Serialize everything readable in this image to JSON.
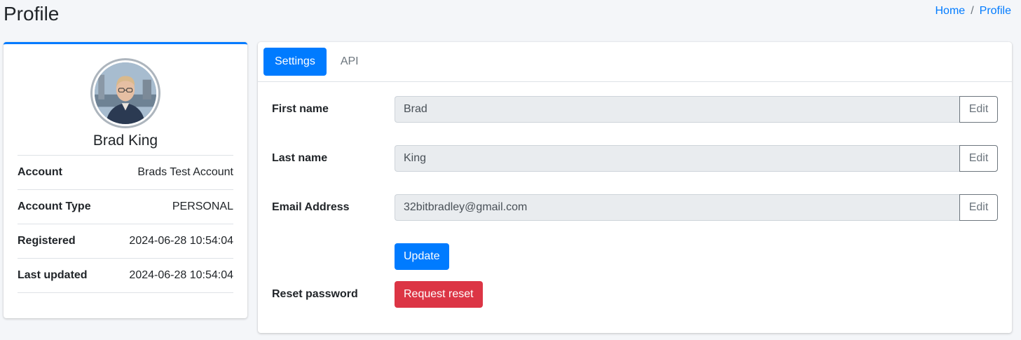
{
  "page": {
    "title": "Profile"
  },
  "breadcrumb": {
    "home": "Home",
    "separator": "/",
    "current": "Profile"
  },
  "profile": {
    "name": "Brad King",
    "rows": [
      {
        "label": "Account",
        "value": "Brads Test Account"
      },
      {
        "label": "Account Type",
        "value": "PERSONAL"
      },
      {
        "label": "Registered",
        "value": "2024-06-28 10:54:04"
      },
      {
        "label": "Last updated",
        "value": "2024-06-28 10:54:04"
      }
    ]
  },
  "tabs": [
    {
      "label": "Settings",
      "active": true
    },
    {
      "label": "API",
      "active": false
    }
  ],
  "form": {
    "first_name": {
      "label": "First name",
      "value": "Brad",
      "button": "Edit"
    },
    "last_name": {
      "label": "Last name",
      "value": "King",
      "button": "Edit"
    },
    "email": {
      "label": "Email Address",
      "value": "32bitbradley@gmail.com",
      "button": "Edit"
    },
    "update_button": "Update",
    "reset": {
      "label": "Reset password",
      "button": "Request reset"
    }
  },
  "colors": {
    "primary": "#007bff",
    "danger": "#dc3545",
    "background": "#f4f6f9"
  }
}
